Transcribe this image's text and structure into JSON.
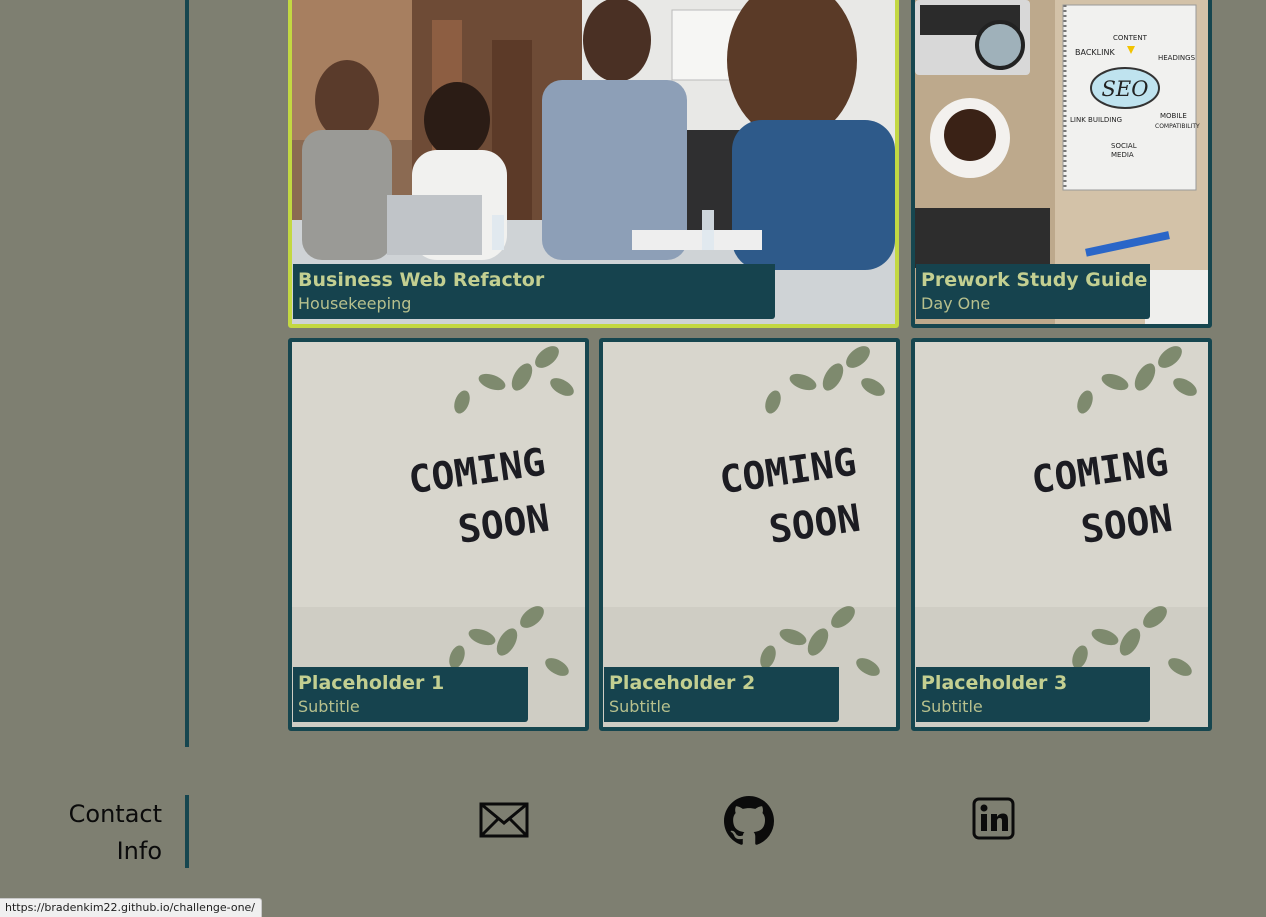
{
  "projects": [
    {
      "title": "Business Web Refactor",
      "subtitle": "Housekeeping"
    },
    {
      "title": "Prework Study Guide",
      "subtitle": "Day One"
    },
    {
      "title": "Placeholder 1",
      "subtitle": "Subtitle"
    },
    {
      "title": "Placeholder 2",
      "subtitle": "Subtitle"
    },
    {
      "title": "Placeholder 3",
      "subtitle": "Subtitle"
    }
  ],
  "coming_soon": {
    "line1": "COMING",
    "line2": "SOON"
  },
  "seo_note": {
    "center": "SEO",
    "backlink": "BACKLINK",
    "content": "CONTENT",
    "headings": "HEADINGS",
    "link_building": "LINK BUILDING",
    "mobile": "MOBILE",
    "compatibility": "COMPATIBILITY",
    "social": "SOCIAL",
    "media": "MEDIA"
  },
  "contact": {
    "heading_line1": "Contact",
    "heading_line2": "Info",
    "icons": [
      "email-icon",
      "github-icon",
      "linkedin-icon"
    ]
  },
  "status_bar": {
    "url": "https://bradenkim22.github.io/challenge-one/"
  },
  "colors": {
    "background": "#7e7f71",
    "accent_line": "#16464f",
    "card_border": "#16464f",
    "active_border": "#c3d842",
    "label_bg": "#16434e",
    "label_title": "#c3cf91"
  }
}
